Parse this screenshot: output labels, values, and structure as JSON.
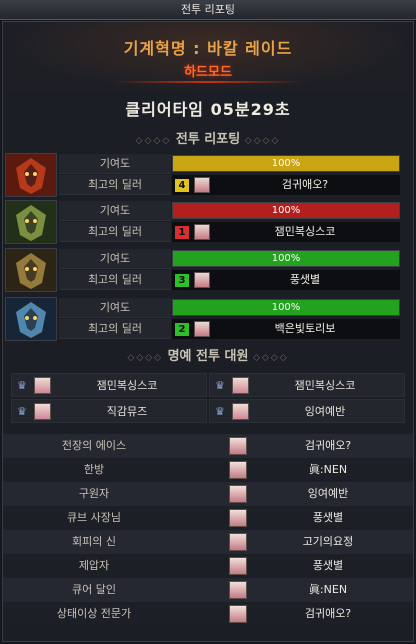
{
  "window": {
    "title": "전투 리포팅"
  },
  "header": {
    "raid_title": "기계혁명 : 바칼 레이드",
    "mode": "하드모드"
  },
  "clear_time": "클리어타임 05분29초",
  "sections": {
    "report": "전투 리포팅",
    "honor": "명예 전투 대원"
  },
  "labels": {
    "contribution": "기여도",
    "top_dealer": "최고의 딜러"
  },
  "parties": [
    {
      "boss_icon": "red-dragon-boss-icon",
      "contribution_text": "100%",
      "contribution_pct": 100,
      "bar_color": "#c9a514",
      "rank": "4",
      "rank_color": "#e3c21c",
      "dealer": "검귀애오?"
    },
    {
      "boss_icon": "green-dragon-boss-icon",
      "contribution_text": "100%",
      "contribution_pct": 100,
      "bar_color": "#b11f1f",
      "rank": "1",
      "rank_color": "#d63030",
      "dealer": "잼민복싱스코"
    },
    {
      "boss_icon": "gold-dragon-boss-icon",
      "contribution_text": "100%",
      "contribution_pct": 100,
      "bar_color": "#22a21f",
      "rank": "3",
      "rank_color": "#2fbf2b",
      "dealer": "풍샛별"
    },
    {
      "boss_icon": "blue-dragon-boss-icon",
      "contribution_text": "100%",
      "contribution_pct": 100,
      "bar_color": "#22a21f",
      "rank": "2",
      "rank_color": "#2fbf2b",
      "dealer": "백은빛토리보"
    }
  ],
  "honor": [
    "잼민복싱스코",
    "잼민복싱스코",
    "직감뮤즈",
    "잉여예반"
  ],
  "awards": [
    {
      "title": "전장의 에이스",
      "name": "검귀애오?"
    },
    {
      "title": "한방",
      "name": "眞:NEN"
    },
    {
      "title": "구원자",
      "name": "잉여예반"
    },
    {
      "title": "큐브 사장님",
      "name": "풍샛별"
    },
    {
      "title": "회피의 신",
      "name": "고기의요정"
    },
    {
      "title": "제압자",
      "name": "풍샛별"
    },
    {
      "title": "큐어 달인",
      "name": "眞:NEN"
    },
    {
      "title": "상태이상 전문가",
      "name": "검귀애오?"
    }
  ]
}
